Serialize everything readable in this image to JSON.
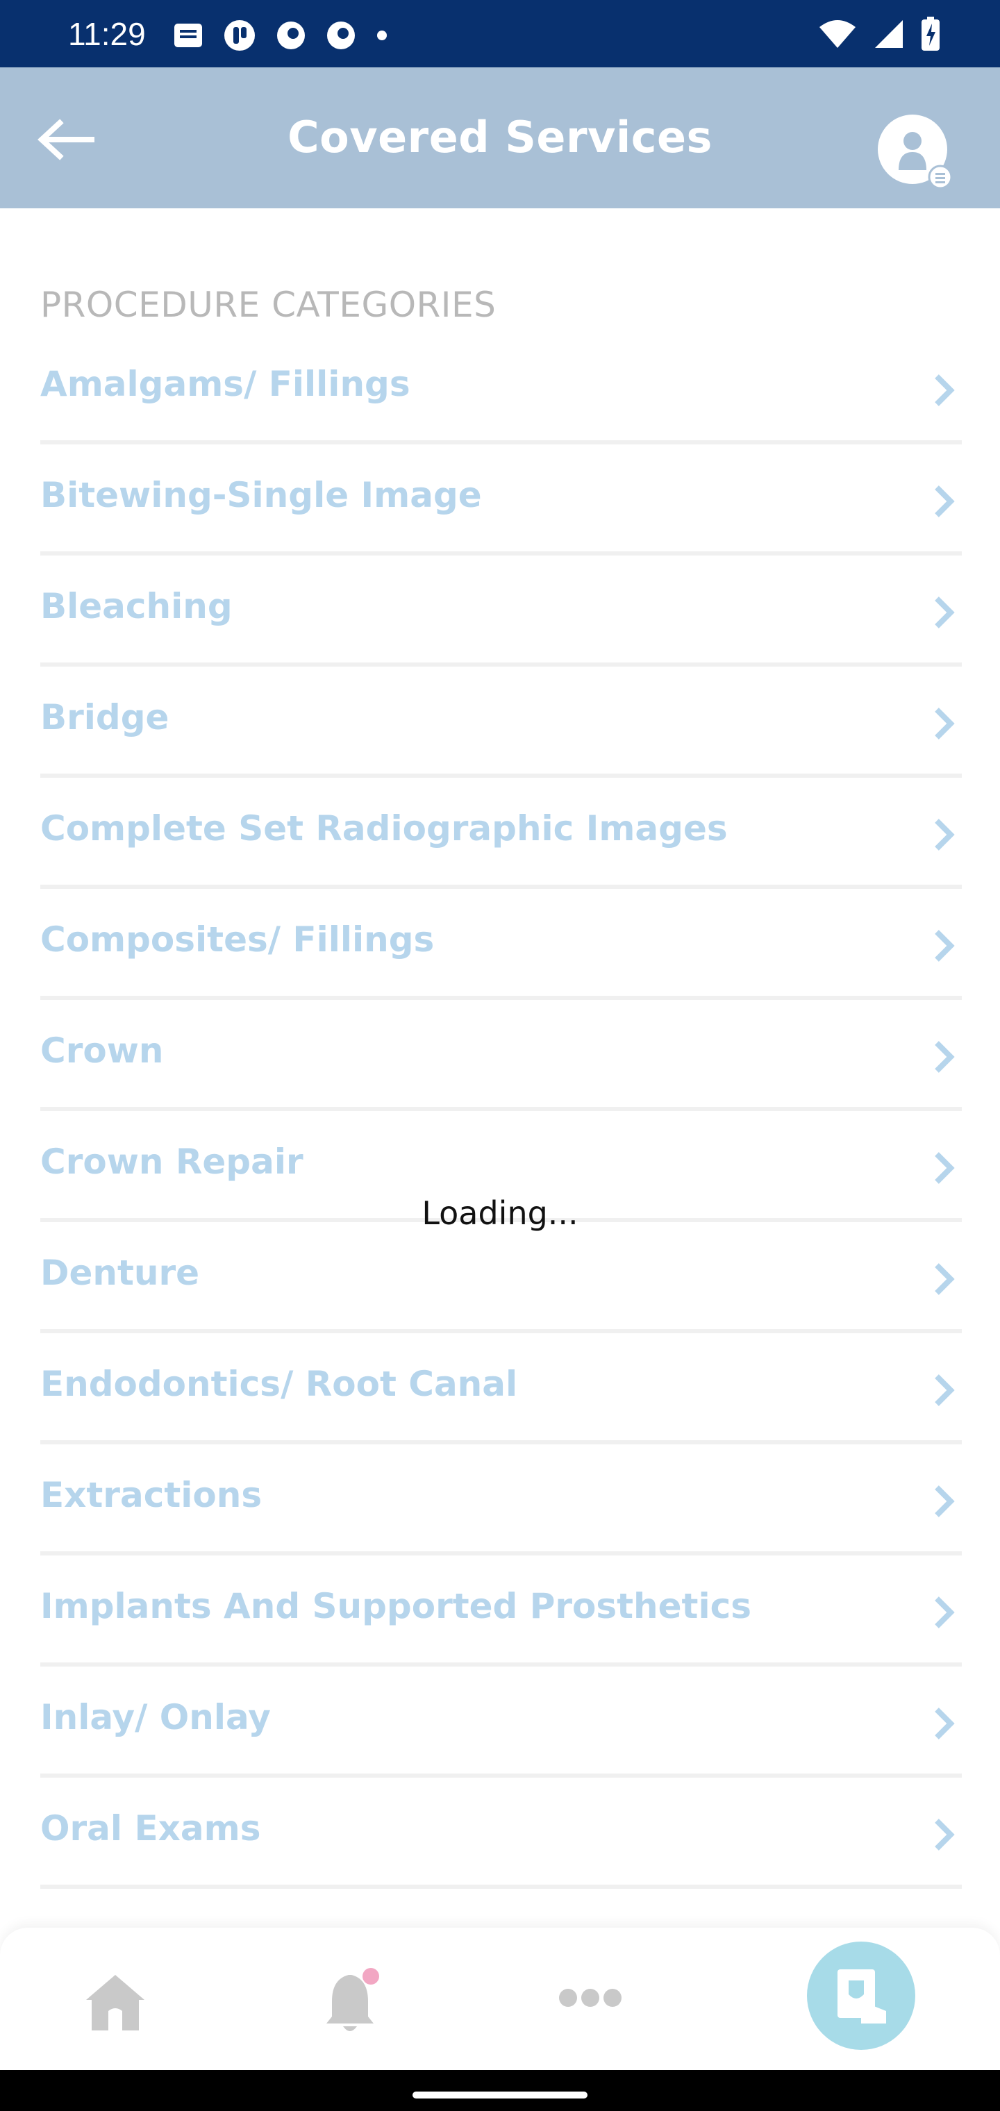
{
  "status_bar": {
    "time": "11:29",
    "left_icons": [
      "message-icon",
      "app-notification-icon",
      "app-notification-icon",
      "app-notification-icon",
      "dot-icon"
    ],
    "right_icons": [
      "wifi-icon",
      "cell-signal-icon",
      "battery-icon"
    ]
  },
  "header": {
    "title": "Covered Services",
    "back_icon": "arrow-left-icon",
    "profile_icon": "profile-icon"
  },
  "list": {
    "section_label": "PROCEDURE CATEGORIES",
    "items": [
      {
        "label": "Amalgams/ Fillings"
      },
      {
        "label": "Bitewing-Single Image"
      },
      {
        "label": "Bleaching"
      },
      {
        "label": "Bridge"
      },
      {
        "label": "Complete Set Radiographic Images"
      },
      {
        "label": "Composites/ Fillings"
      },
      {
        "label": "Crown"
      },
      {
        "label": "Crown Repair"
      },
      {
        "label": "Denture"
      },
      {
        "label": "Endodontics/ Root Canal"
      },
      {
        "label": "Extractions"
      },
      {
        "label": "Implants And Supported Prosthetics"
      },
      {
        "label": "Inlay/ Onlay"
      },
      {
        "label": "Oral Exams"
      }
    ]
  },
  "loading": {
    "text": "Loading..."
  },
  "bottom_nav": {
    "items": [
      "home-icon",
      "notifications-icon",
      "more-icon",
      "id-card-icon"
    ],
    "notification_badge_color": "#f2a7c3",
    "active_color": "#a7dbe8"
  },
  "colors": {
    "status_bar": "#08306e",
    "header": "#a9c0d6",
    "item_text": "#b6d5ec",
    "section_label": "#b8b8b8"
  }
}
